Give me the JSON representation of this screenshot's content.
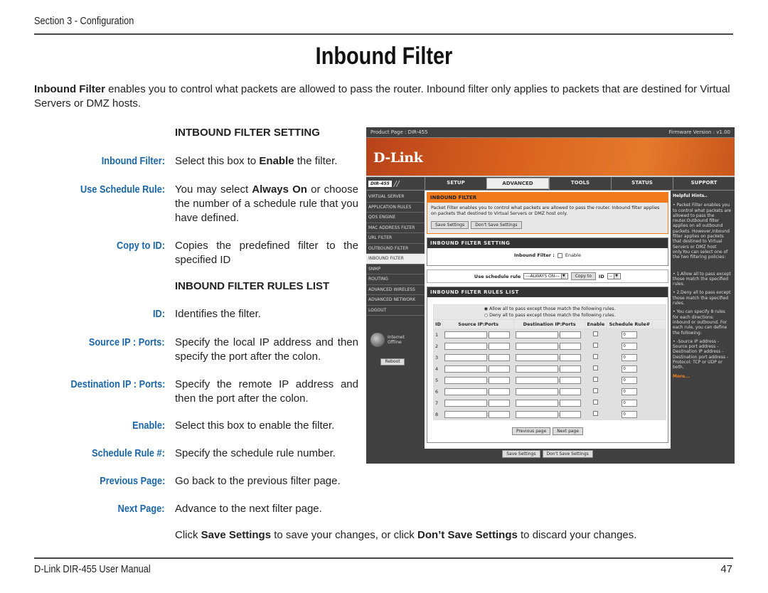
{
  "header": {
    "section": "Section 3 - Configuration"
  },
  "title": "Inbound Filter",
  "intro": {
    "bold": "Inbound Filter",
    "text": " enables you to control what packets are allowed to pass the router. Inbound filter only applies to packets that are destined for Virtual Servers or DMZ hosts."
  },
  "setting_heading": "INTBOUND FILTER SETTING",
  "rules_heading": "INBOUND FILTER RULES LIST",
  "definitions": [
    {
      "label": "Inbound Filter:",
      "pre": "Select this box to ",
      "bold": "Enable",
      "post": " the filter."
    },
    {
      "label": "Use Schedule Rule:",
      "pre": "You may select ",
      "bold": "Always On",
      "post": " or choose the number of a schedule rule that you have defined."
    },
    {
      "label": "Copy to ID:",
      "pre": "Copies the predefined filter to the specified ID",
      "bold": "",
      "post": ""
    },
    {
      "label": "ID:",
      "pre": "Identifies the filter.",
      "bold": "",
      "post": ""
    },
    {
      "label": "Source IP : Ports:",
      "pre": "Specify the local IP address and then specify the port after the colon.",
      "bold": "",
      "post": ""
    },
    {
      "label": "Destination IP : Ports:",
      "pre": "Specify the remote IP address and then the port after the colon.",
      "bold": "",
      "post": ""
    },
    {
      "label": "Enable:",
      "pre": "Select this box to enable the filter.",
      "bold": "",
      "post": ""
    },
    {
      "label": "Schedule Rule #:",
      "pre": "Specify the schedule rule number.",
      "bold": "",
      "post": ""
    },
    {
      "label": "Previous Page:",
      "pre": "Go back to the previous filter page.",
      "bold": "",
      "post": ""
    },
    {
      "label": "Next Page:",
      "pre": "Advance to the next filter page.",
      "bold": "",
      "post": ""
    }
  ],
  "save_note": {
    "pre": "Click ",
    "b1": "Save Settings",
    "mid": " to save your changes, or click ",
    "b2": "Don’t Save Settings",
    "post": " to discard your changes."
  },
  "footer": {
    "left": "D-Link DIR-455 User Manual",
    "page": "47"
  },
  "router": {
    "product_page": "Product Page :  DIR-455",
    "firmware": "Firmware Version : v1.00",
    "logo": "D-Link",
    "model": "DIR-455",
    "tabs": [
      "SETUP",
      "ADVANCED",
      "TOOLS",
      "STATUS",
      "SUPPORT"
    ],
    "active_tab": "ADVANCED",
    "sidebar": [
      "VIRTUAL SERVER",
      "APPLICATION RULES",
      "QOS ENGINE",
      "MAC ADDRESS FILTER",
      "URL FILTER",
      "OUTBOUND FILTER",
      "INBOUND FILTER",
      "SNMP",
      "ROUTING",
      "ADVANCED WIRELESS",
      "ADVANCED NETWORK",
      "LOGOUT"
    ],
    "active_side": "INBOUND FILTER",
    "internet_status": "Internet Offline",
    "reboot": "Reboot",
    "filter_title": "INBOUND FILTER",
    "filter_desc": "Packet Filter enables you to control what packets are allowed to pass the router. Inbound filter applies on packets that destined to Virtual Servers or DMZ host only.",
    "save": "Save Settings",
    "dont_save": "Don't Save Settings",
    "setting_title": "INBOUND FILTER SETTING",
    "inbound_label": "Inbound Filter :",
    "enable_label": "Enable",
    "schedule_label": "Use schedule rule",
    "schedule_value": "---ALWAYS ON---",
    "copy_to": "Copy to",
    "id_label": "ID",
    "id_value": "--",
    "rules_title": "INBOUND FILTER RULES LIST",
    "allow_text": "Allow all to pass except those match the following rules.",
    "deny_text": "Deny all to pass except those match the following rules.",
    "columns": [
      "ID",
      "Source IP:Ports",
      "Destination IP:Ports",
      "Enable",
      "Schedule Rule#"
    ],
    "rows": [
      {
        "id": "1",
        "sched": "0"
      },
      {
        "id": "2",
        "sched": "0"
      },
      {
        "id": "3",
        "sched": "0"
      },
      {
        "id": "4",
        "sched": "0"
      },
      {
        "id": "5",
        "sched": "0"
      },
      {
        "id": "6",
        "sched": "0"
      },
      {
        "id": "7",
        "sched": "0"
      },
      {
        "id": "8",
        "sched": "0"
      }
    ],
    "prev_page": "Previous page",
    "next_page": "Next page",
    "hints_title": "Helpful Hints..",
    "hints": [
      "• Packet Filter enables you to control what packets are allowed to pass the router.Outbound filter applies on all outbound packets. However,Inbound filter applies on packets that destined to Virtual Servers or DMZ host only.You can select one of the two filtering policies:",
      "• 1.Allow all to pass except those match the specified rules.",
      "• 2.Deny all to pass except those match the specified rules.",
      "• You can specify 8 rules for each directions: inbound or outbound. For each rule, you can define the following:",
      "• -Source IP address -Source port address -Destination IP address -Destination port address -Protocol: TCP or UDP or both."
    ],
    "more": "More..."
  }
}
